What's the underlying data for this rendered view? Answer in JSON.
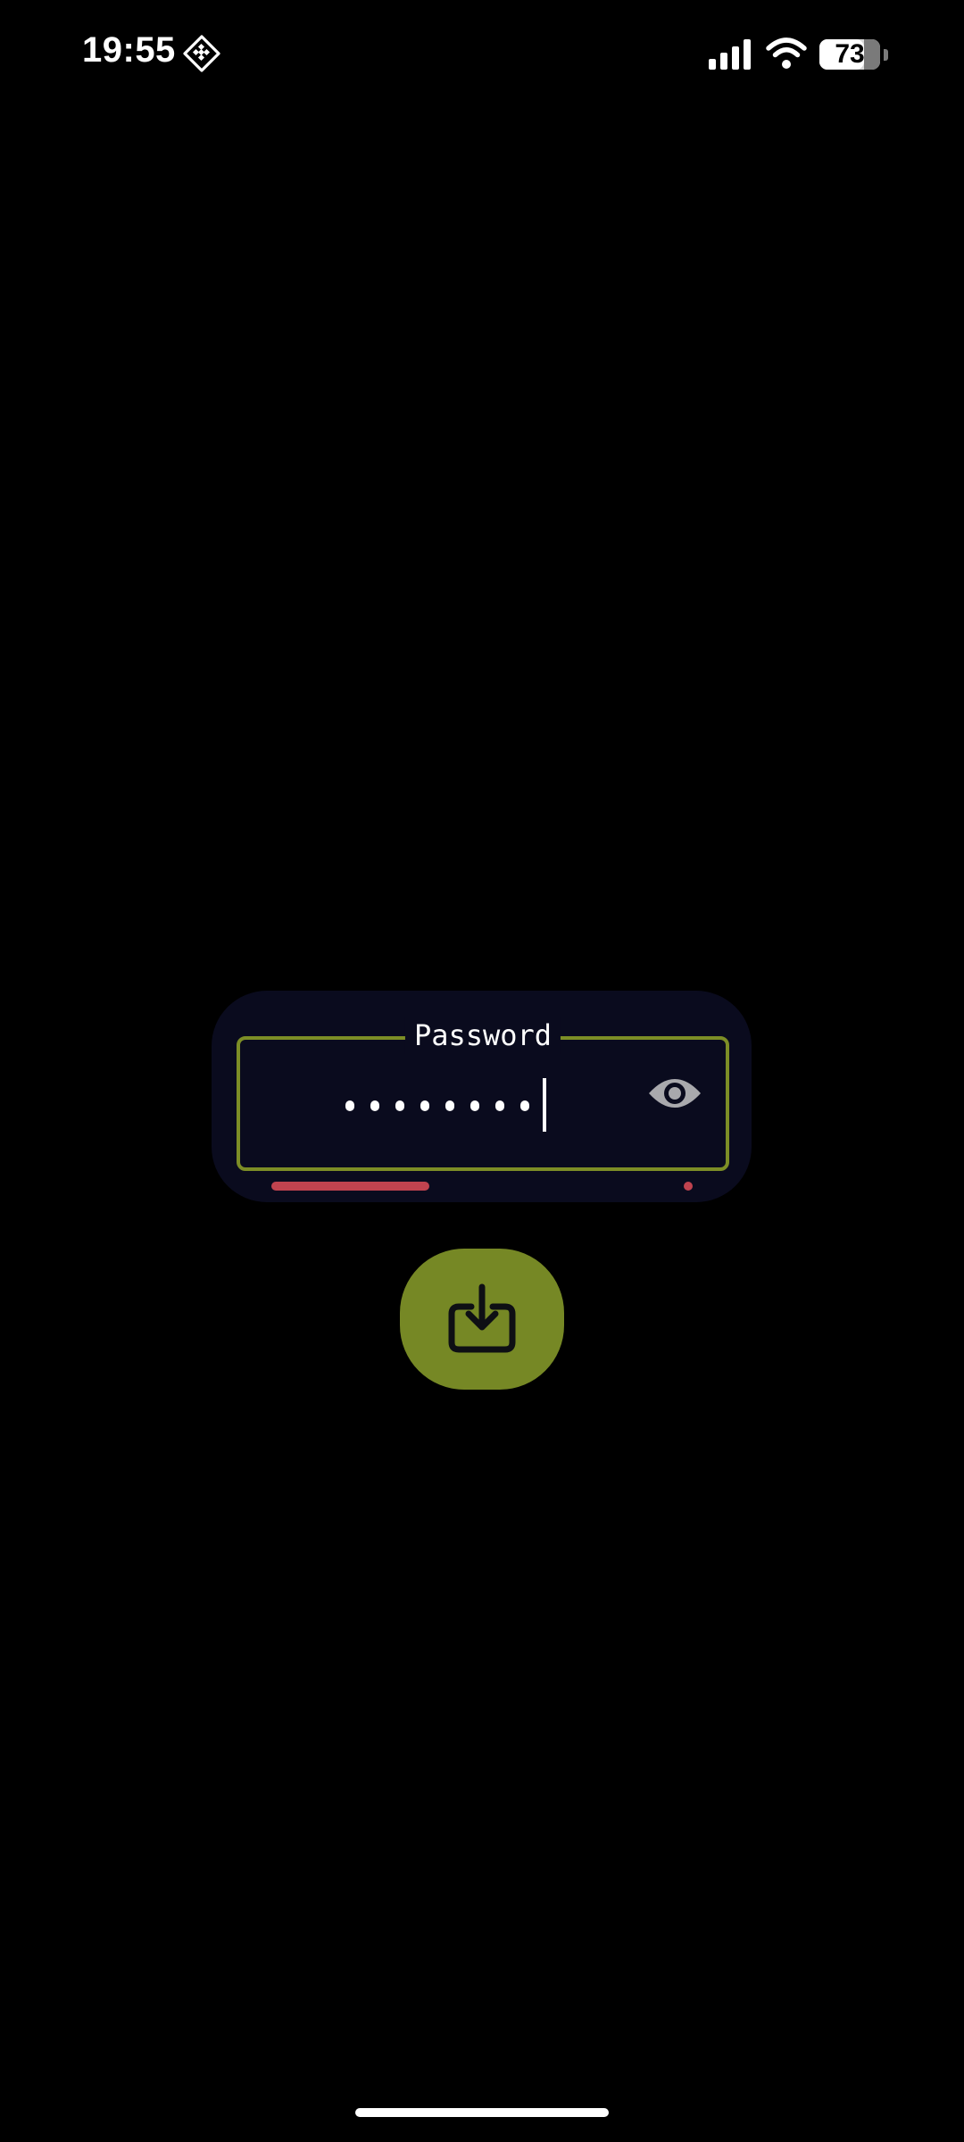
{
  "status_bar": {
    "time": "19:55",
    "app_icon": "diamond-grid-icon",
    "signal_icon": "cellular-signal-icon",
    "wifi_icon": "wifi-icon",
    "battery_level": "73",
    "battery_fraction": 0.73
  },
  "password_form": {
    "label": "Password",
    "masked_length": 8,
    "visibility_toggle_icon": "eye-icon",
    "strength_color": "#c0434f"
  },
  "submit": {
    "icon": "download-tray-icon"
  },
  "colors": {
    "background": "#000000",
    "card": "#0a0b1e",
    "accent": "#768825",
    "border_accent": "#7d8e26",
    "danger": "#c0434f"
  }
}
